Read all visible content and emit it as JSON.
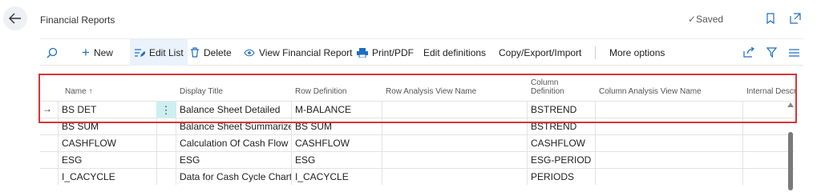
{
  "header": {
    "title": "Financial Reports",
    "saved_label": "Saved"
  },
  "toolbar": {
    "new_label": "New",
    "edit_list_label": "Edit List",
    "delete_label": "Delete",
    "view_report_label": "View Financial Report",
    "print_label": "Print/PDF",
    "edit_definitions_label": "Edit definitions",
    "copy_export_label": "Copy/Export/Import",
    "more_options_label": "More options"
  },
  "table": {
    "headers": {
      "name": "Name ↑",
      "display_title": "Display Title",
      "row_definition": "Row Definition",
      "row_analysis": "Row Analysis View Name",
      "column_definition_1": "Column",
      "column_definition_2": "Definition",
      "column_analysis": "Column Analysis View Name",
      "internal_desc": "Internal Descr"
    },
    "rows": [
      {
        "name": "BS DET",
        "title": "Balance Sheet Detailed",
        "row_def": "M-BALANCE",
        "row_view": "",
        "col_def": "BSTREND",
        "col_view": ""
      },
      {
        "name": "BS SUM",
        "title": "Balance Sheet Summarized",
        "row_def": "BS SUM",
        "row_view": "",
        "col_def": "BSTREND",
        "col_view": ""
      },
      {
        "name": "CASHFLOW",
        "title": "Calculation Of Cash Flow",
        "row_def": "CASHFLOW",
        "row_view": "",
        "col_def": "CASHFLOW",
        "col_view": ""
      },
      {
        "name": "ESG",
        "title": "ESG",
        "row_def": "ESG",
        "row_view": "",
        "col_def": "ESG-PERIOD",
        "col_view": ""
      },
      {
        "name": "I_CACYCLE",
        "title": "Data for Cash Cycle Chart",
        "row_def": "I_CACYCLE",
        "row_view": "",
        "col_def": "PERIODS",
        "col_view": ""
      }
    ]
  },
  "colors": {
    "accent": "#1f6fbf",
    "highlight": "#d9343a",
    "selected_actions": "#cdeff1"
  }
}
